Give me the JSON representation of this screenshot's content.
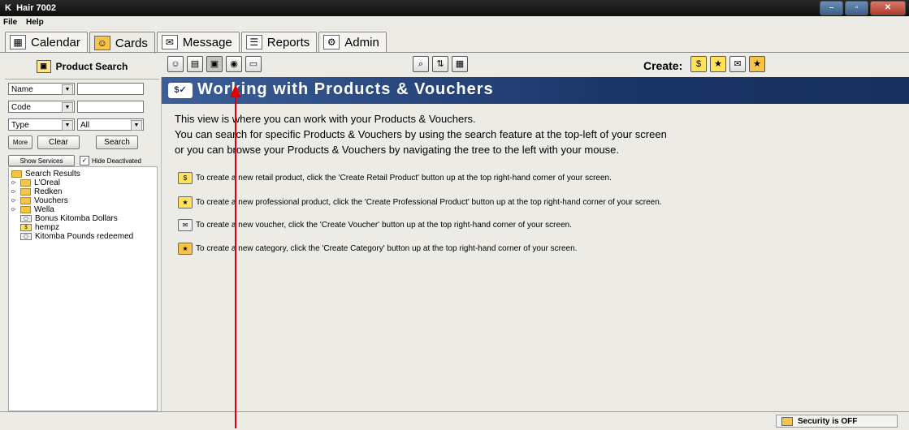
{
  "window": {
    "title": "Hair 7002",
    "logo": "K"
  },
  "menu": {
    "file": "File",
    "help": "Help"
  },
  "tabs": [
    {
      "label": "Calendar",
      "icon": "calendar-icon"
    },
    {
      "label": "Cards",
      "icon": "cards-icon"
    },
    {
      "label": "Message",
      "icon": "message-icon"
    },
    {
      "label": "Reports",
      "icon": "reports-icon"
    },
    {
      "label": "Admin",
      "icon": "admin-icon"
    }
  ],
  "search_panel": {
    "title": "Product Search",
    "field1": {
      "selected": "Name",
      "value": ""
    },
    "field2": {
      "selected": "Code",
      "value": ""
    },
    "field3": {
      "selected": "Type",
      "value": "All"
    },
    "more": "More",
    "clear": "Clear",
    "search": "Search",
    "show_services": "Show Services",
    "hide_deactivated": "Hide Deactivated",
    "hide_deactivated_checked": true
  },
  "tree": {
    "root": "Search Results",
    "items": [
      {
        "label": "L'Oreal",
        "type": "folder"
      },
      {
        "label": "Redken",
        "type": "folder"
      },
      {
        "label": "Vouchers",
        "type": "folder"
      },
      {
        "label": "Wella",
        "type": "folder"
      },
      {
        "label": "Bonus Kitomba Dollars",
        "type": "voucher"
      },
      {
        "label": "hempz",
        "type": "product"
      },
      {
        "label": "Kitomba Pounds redeemed",
        "type": "voucher"
      }
    ]
  },
  "toolbar": {
    "create_label": "Create:"
  },
  "banner": {
    "title": "Working with Products & Vouchers"
  },
  "intro": [
    "This view is where you can work with your Products & Vouchers.",
    "You can search for specific Products & Vouchers by using the search feature at the top-left of your screen",
    "or you can browse your Products & Vouchers by navigating the tree to the left with your mouse."
  ],
  "instructions": [
    {
      "text": "To create a new retail product, click the 'Create Retail Product' button up at the top right-hand corner of your screen.",
      "icon": "retail-product-icon"
    },
    {
      "text": "To create a new professional product, click the 'Create Professional Product' button up at the top right-hand corner of your screen.",
      "icon": "professional-product-icon"
    },
    {
      "text": "To create a new voucher, click the 'Create Voucher' button up at the top right-hand corner of your screen.",
      "icon": "voucher-icon"
    },
    {
      "text": "To create a new category, click the 'Create Category' button up at the top right-hand corner of your screen.",
      "icon": "category-icon"
    }
  ],
  "status": {
    "security": "Security is OFF"
  },
  "colors": {
    "banner": "#1b3568",
    "annotation": "#e00000"
  }
}
